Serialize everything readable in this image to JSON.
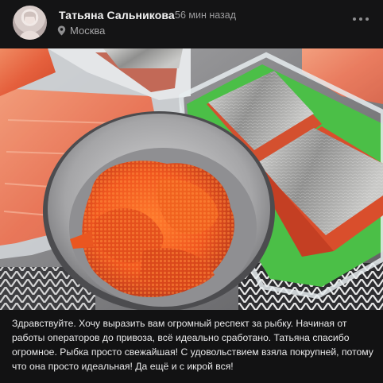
{
  "post": {
    "author": "Татьяна Сальникова",
    "time": "56 мин назад",
    "location": "Москва",
    "caption": "Здравствуйте. Хочу выразить вам огромный респект за рыбку. Начиная от работы операторов до привоза, всё идеально сработано. Татьяна спасибо огромное. Рыбка просто свежайшая! С удовольствием взяла покрупней, потому что она просто идеальная! Да ещё и с икрой вся!"
  },
  "icons": {
    "location": "location-pin-icon",
    "more": "more-horizontal-icon"
  },
  "colors": {
    "background": "#121213",
    "text_primary": "#f2f2f2",
    "text_secondary": "#9a9a9c"
  }
}
